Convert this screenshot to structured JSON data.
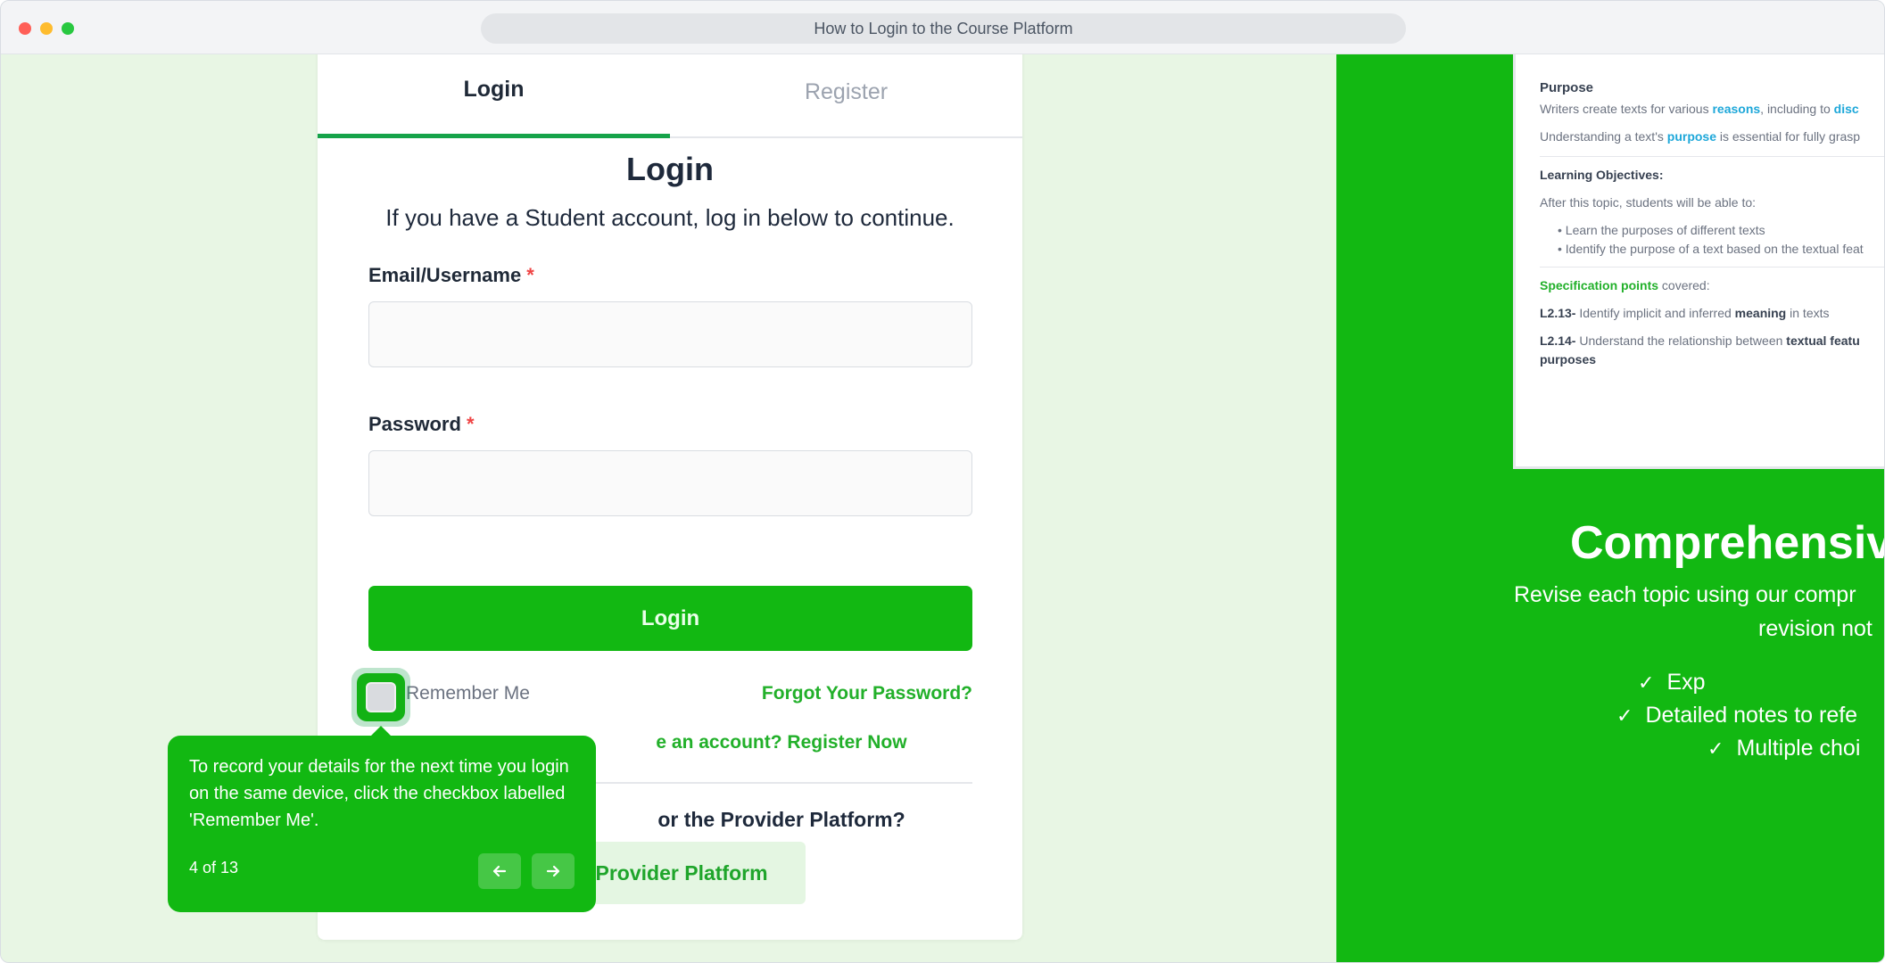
{
  "window": {
    "title": "How to Login to the Course Platform"
  },
  "tabs": {
    "login": "Login",
    "register": "Register"
  },
  "form": {
    "title": "Login",
    "subtitle": "If you have a Student account, log in below to continue.",
    "email_label": "Email/Username",
    "password_label": "Password",
    "required_mark": "*",
    "email_value": "",
    "password_value": "",
    "login_button": "Login",
    "remember_me": "Remember Me",
    "remember_checked": false,
    "forgot_password": "Forgot Your Password?",
    "register_prompt": "e an account? Register Now",
    "provider_question": "or the Provider Platform?",
    "provider_button": "t Provider Platform"
  },
  "tooltip": {
    "text": "To record your details for the next time you login on the same device, click the checkbox labelled 'Remember Me'.",
    "step": "4 of 13",
    "prev_icon": "arrow-left-icon",
    "next_icon": "arrow-right-icon"
  },
  "preview": {
    "purpose_heading": "Purpose",
    "line1_a": "Writers create texts for various ",
    "line1_b": "reasons",
    "line1_c": ", including to ",
    "line1_d": "disc",
    "line2_a": "Understanding a text's ",
    "line2_b": "purpose",
    "line2_c": " is essential for fully grasp",
    "objectives_heading": "Learning Objectives:",
    "objectives_intro": "After this topic, students will be able to:",
    "objective_1": "Learn the purposes of different texts",
    "objective_2": "Identify the purpose of a text based on the textual feat",
    "spec_a": "Specification points",
    "spec_b": " covered:",
    "spec1_code": "L2.13-",
    "spec1_a": " Identify implicit and inferred ",
    "spec1_b": "meaning",
    "spec1_c": " in texts",
    "spec2_code": "L2.14-",
    "spec2_a": " Understand the relationship between ",
    "spec2_b": "textual featu",
    "spec2_c": "purposes"
  },
  "hero": {
    "title": "Comprehensiv",
    "subtitle_1": "Revise each topic using our compr",
    "subtitle_2": "revision not",
    "items": [
      "Exp",
      "Detailed notes to refe",
      "Multiple choi"
    ]
  },
  "colors": {
    "brand_green": "#12b812",
    "link_green": "#22b02a",
    "required_red": "#ef4444",
    "background": "#e8f6e4"
  }
}
